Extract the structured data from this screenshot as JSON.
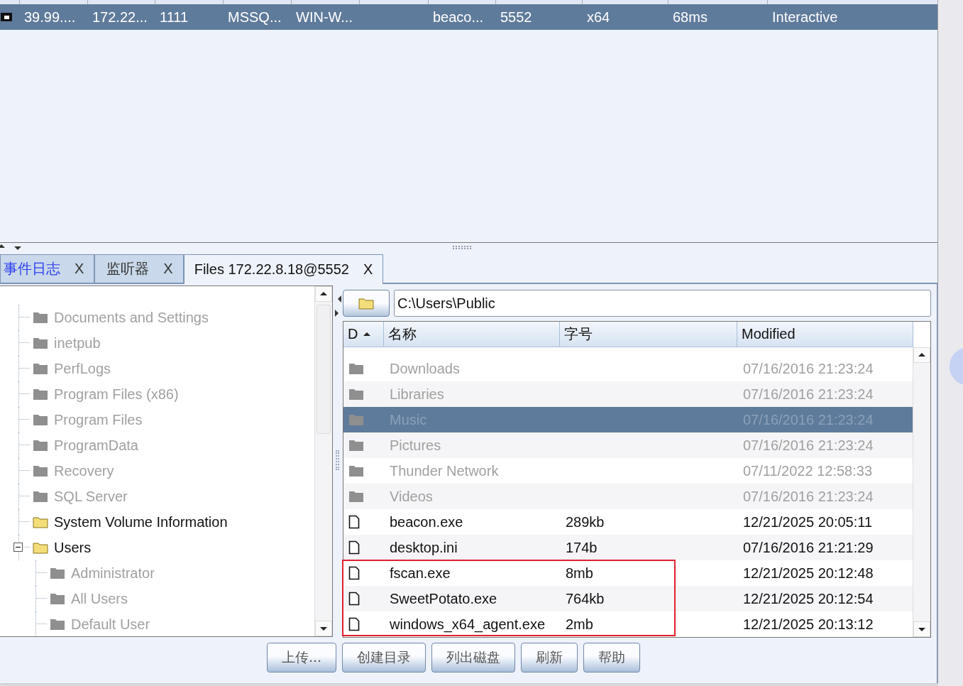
{
  "sessions": {
    "rows": [
      {
        "selected": true,
        "cells": [
          "39.99....",
          "172.22...",
          "1111",
          "MSSQ...",
          "WIN-W...",
          "",
          "beaco...",
          "5552",
          "x64",
          "68ms",
          "Interactive"
        ]
      }
    ]
  },
  "tabs": [
    {
      "label": "事件日志",
      "selected": false,
      "highlighted": true,
      "close": "X"
    },
    {
      "label": "监听器",
      "selected": false,
      "highlighted": false,
      "close": "X"
    },
    {
      "label": "Files 172.22.8.18@5552",
      "selected": true,
      "highlighted": false,
      "close": "X"
    }
  ],
  "tree": {
    "items": [
      {
        "label": "Documents and Settings",
        "disabled": true
      },
      {
        "label": "inetpub",
        "disabled": true
      },
      {
        "label": "PerfLogs",
        "disabled": true
      },
      {
        "label": "Program Files (x86)",
        "disabled": true
      },
      {
        "label": "Program Files",
        "disabled": true
      },
      {
        "label": "ProgramData",
        "disabled": true
      },
      {
        "label": "Recovery",
        "disabled": true
      },
      {
        "label": "SQL Server",
        "disabled": true
      },
      {
        "label": "System Volume Information",
        "disabled": false
      },
      {
        "label": "Users",
        "disabled": false,
        "expanded": true,
        "children": [
          {
            "label": "Administrator",
            "disabled": true
          },
          {
            "label": "All Users",
            "disabled": true
          },
          {
            "label": "Default User",
            "disabled": true
          }
        ]
      }
    ]
  },
  "path": {
    "value": "C:\\Users\\Public"
  },
  "files": {
    "columns": [
      {
        "label": "D",
        "sorted": true
      },
      {
        "label": "名称"
      },
      {
        "label": "字号"
      },
      {
        "label": "Modified"
      }
    ],
    "rows": [
      {
        "kind": "folder",
        "name": "Downloads",
        "modified": "07/16/2016 21:23:24",
        "selected": false,
        "disabled": true,
        "outlined": false
      },
      {
        "kind": "folder",
        "name": "Libraries",
        "modified": "07/16/2016 21:23:24",
        "selected": false,
        "disabled": true,
        "outlined": false
      },
      {
        "kind": "folder",
        "name": "Music",
        "modified": "07/16/2016 21:23:24",
        "selected": true,
        "disabled": true,
        "outlined": false
      },
      {
        "kind": "folder",
        "name": "Pictures",
        "modified": "07/16/2016 21:23:24",
        "selected": false,
        "disabled": true,
        "outlined": false
      },
      {
        "kind": "folder",
        "name": "Thunder Network",
        "modified": "07/11/2022 12:58:33",
        "selected": false,
        "disabled": true,
        "outlined": false
      },
      {
        "kind": "folder",
        "name": "Videos",
        "modified": "07/16/2016 21:23:24",
        "selected": false,
        "disabled": true,
        "outlined": false
      },
      {
        "kind": "file",
        "name": "beacon.exe",
        "size": "289kb",
        "modified": "12/21/2025 20:05:11",
        "selected": false,
        "disabled": false,
        "outlined": false
      },
      {
        "kind": "file",
        "name": "desktop.ini",
        "size": "174b",
        "modified": "07/16/2016 21:21:29",
        "selected": false,
        "disabled": false,
        "outlined": false
      },
      {
        "kind": "file",
        "name": "fscan.exe",
        "size": "8mb",
        "modified": "12/21/2025 20:12:48",
        "selected": false,
        "disabled": false,
        "outlined": true
      },
      {
        "kind": "file",
        "name": "SweetPotato.exe",
        "size": "764kb",
        "modified": "12/21/2025 20:12:54",
        "selected": false,
        "disabled": false,
        "outlined": true
      },
      {
        "kind": "file",
        "name": "windows_x64_agent.exe",
        "size": "2mb",
        "modified": "12/21/2025 20:13:12",
        "selected": false,
        "disabled": false,
        "outlined": true
      }
    ]
  },
  "buttons": [
    "上传...",
    "创建目录",
    "列出磁盘",
    "刷新",
    "帮助"
  ]
}
